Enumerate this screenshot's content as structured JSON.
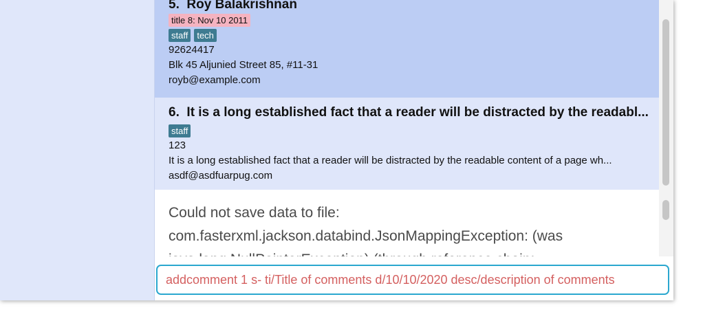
{
  "person_list": {
    "cards": [
      {
        "index": "5.",
        "name": "Roy Balakrishnan",
        "remark": "title 8: Nov 10 2011",
        "tags": [
          "staff",
          "tech"
        ],
        "phone": "92624417",
        "address": "Blk 45 Aljunied Street 85, #11-31",
        "email": "royb@example.com"
      },
      {
        "index": "6.",
        "name": "It is a long established fact that a reader will be distracted by the readabl...",
        "tags": [
          "staff"
        ],
        "phone": "123",
        "address": "It is a long established fact that a reader will be distracted by the readable content of a page wh...",
        "email": "asdf@asdfuarpug.com"
      }
    ]
  },
  "result_display": {
    "lines": [
      "Could not save data to file:",
      "com.fasterxml.jackson.databind.JsonMappingException: (was",
      "java.lang.NullPointerException) (through reference chain:"
    ]
  },
  "command_box": {
    "value": "addcomment 1 s- ti/Title of comments d/10/10/2020 desc/description of comments"
  },
  "colors": {
    "selected_card": "#bccdf4",
    "card": "#dfe6fa",
    "tag": "#3e7b91",
    "remark": "#f5b3c0",
    "command_border": "#2aa7cf",
    "command_text": "#d45f5f"
  }
}
